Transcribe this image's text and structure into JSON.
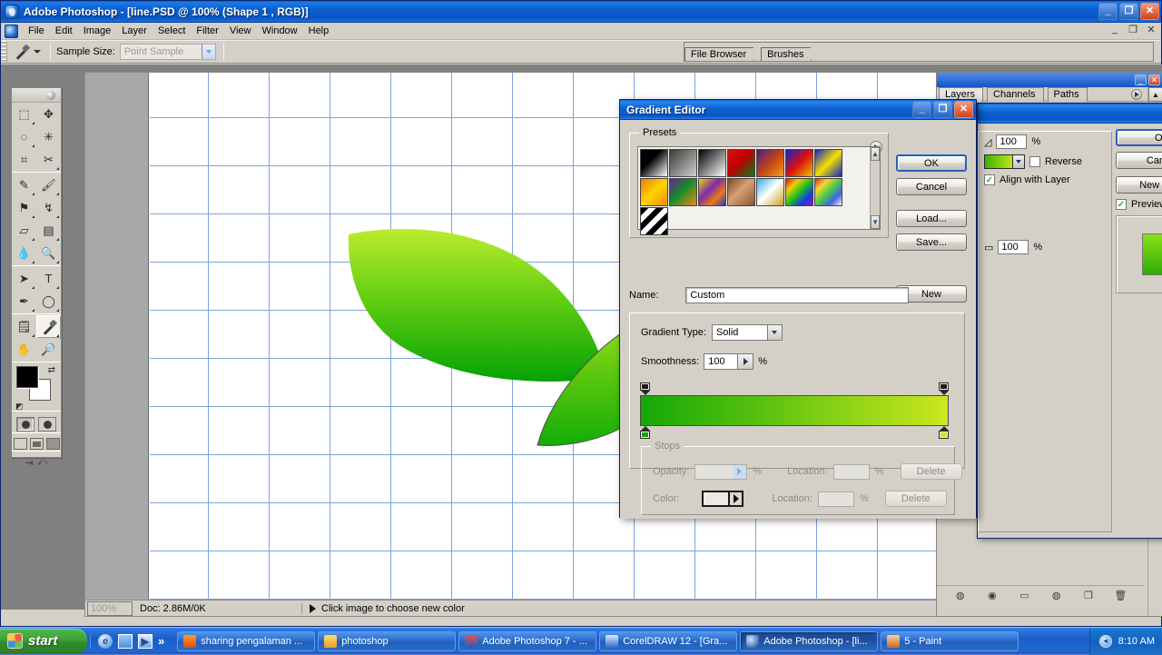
{
  "app": {
    "title": "Adobe Photoshop  - [line.PSD @ 100% (Shape 1 , RGB)]",
    "menus": [
      "File",
      "Edit",
      "Image",
      "Layer",
      "Select",
      "Filter",
      "View",
      "Window",
      "Help"
    ],
    "window_buttons": {
      "minimize": "_",
      "restore": "❐",
      "close": "✕"
    },
    "mdi_buttons": {
      "minimize": "_",
      "restore": "❐",
      "close": "✕"
    }
  },
  "options_bar": {
    "tool_icon": "eyedropper-icon",
    "sample_size_label": "Sample Size:",
    "sample_size_value": "Point Sample",
    "palette_well_tabs": [
      "File Browser",
      "Brushes"
    ]
  },
  "toolbox": {
    "tools": [
      "marquee-icon",
      "move-icon",
      "lasso-icon",
      "magic-wand-icon",
      "crop-icon",
      "slice-icon",
      "healing-brush-icon",
      "paintbrush-icon",
      "clone-stamp-icon",
      "history-brush-icon",
      "eraser-icon",
      "gradient-icon",
      "blur-icon",
      "dodge-icon",
      "path-selection-icon",
      "type-icon",
      "pen-icon",
      "ellipse-shape-icon",
      "notes-icon",
      "eyedropper-icon",
      "hand-icon",
      "zoom-icon"
    ],
    "selected_tool": "eyedropper-icon",
    "foreground_color": "#000000",
    "background_color": "#ffffff",
    "swap_icon": "swap-colors-icon",
    "default_icon": "default-colors-icon",
    "quickmask_modes": [
      "standard-mask-icon",
      "quick-mask-icon"
    ],
    "screen_modes": [
      "standard-screen-icon",
      "full-screen-menubar-icon",
      "full-screen-icon"
    ],
    "jump_to": [
      "jump-to-imageready-icon",
      "jump-to-second-icon"
    ]
  },
  "document": {
    "zoom": "100%",
    "doc_info": "Doc: 2.86M/0K",
    "status_hint": "Click image to choose new color",
    "canvas_background": "#ffffff",
    "grid_color": "#7ea3dd",
    "shapes": [
      {
        "name": "leaf-large",
        "gradient_from": "#b7e830",
        "gradient_to": "#0aa80a"
      },
      {
        "name": "leaf-small",
        "gradient_from": "#9be01a",
        "gradient_to": "#18b008"
      }
    ]
  },
  "layers_palette": {
    "tabs": [
      "Layers",
      "Channels",
      "Paths"
    ],
    "active_tab": "Layers",
    "bottom_icons": [
      "layer-style-icon",
      "layer-mask-icon",
      "new-group-icon",
      "adjustment-layer-icon",
      "new-layer-icon",
      "delete-layer-icon"
    ],
    "window_buttons": {
      "minimize": "_",
      "close": "✕"
    }
  },
  "gradient_editor": {
    "title": "Gradient Editor",
    "window_buttons": {
      "minimize": "_",
      "restore": "❐",
      "close": "✕"
    },
    "presets": {
      "legend": "Presets",
      "menu_icon": "preset-menu-icon",
      "scroll_up_icon": "scroll-up-icon",
      "scroll_down_icon": "scroll-down-icon",
      "items": [
        {
          "name": "foreground-to-background",
          "css": "linear-gradient(135deg,#000 0%,#000 38%,#ffffff 100%)"
        },
        {
          "name": "foreground-to-transparent",
          "css": "linear-gradient(135deg,#3a3a3a 0%,rgba(140,140,140,0.35) 100%)"
        },
        {
          "name": "black-white",
          "css": "linear-gradient(135deg,#000000 0%,#ffffff 100%)"
        },
        {
          "name": "red-green",
          "css": "linear-gradient(135deg,#e01010 0%,#c00000 45%,#0a7a18 100%)"
        },
        {
          "name": "violet-orange",
          "css": "linear-gradient(135deg,#4b1b8c 0%,#c84a10 55%,#f2a020 100%)"
        },
        {
          "name": "blue-red-yellow",
          "css": "linear-gradient(135deg,#1422c8 0%,#d81010 50%,#f5c000 100%)"
        },
        {
          "name": "blue-yellow-blue",
          "css": "linear-gradient(135deg,#1422c8 0%,#f5e000 50%,#1422c8 100%)"
        },
        {
          "name": "orange-yellow-orange",
          "css": "linear-gradient(135deg,#f07808 0%,#ffd400 50%,#f08c08 100%)"
        },
        {
          "name": "violet-green-orange",
          "css": "linear-gradient(135deg,#6a1e9c 0%,#148c2a 45%,#ef8a12 100%)"
        },
        {
          "name": "yellow-violet-orange-blue",
          "css": "linear-gradient(135deg,#f5d000 0%,#7a2ab0 40%,#ef7a12 70%,#1a3ad0 100%)"
        },
        {
          "name": "copper",
          "css": "linear-gradient(135deg,#7a4a28 0%,#d8a074 45%,#8a5632 100%)"
        },
        {
          "name": "chrome",
          "css": "linear-gradient(135deg,#3aa8e8 0%,#ffffff 48%,#c8a020 100%)"
        },
        {
          "name": "spectrum",
          "css": "linear-gradient(135deg,#e81010 0%,#f0d000 25%,#20c020 50%,#1040e0 75%,#9010c0 100%)"
        },
        {
          "name": "transparent-rainbow",
          "css": "linear-gradient(135deg,rgba(232,16,16,0.9) 0%,rgba(240,208,0,0.8) 25%,rgba(32,192,32,0.8) 50%,rgba(16,64,224,0.8) 75%,rgba(255,255,255,0.2) 100%)"
        },
        {
          "name": "transparent-stripes",
          "css": "repeating-linear-gradient(135deg,#000 0 6px,#ffffff 6px 12px)"
        }
      ]
    },
    "buttons": {
      "ok": "OK",
      "cancel": "Cancel",
      "load": "Load...",
      "save": "Save...",
      "new": "New"
    },
    "name_label": "Name:",
    "name_value": "Custom",
    "gradient_type_label": "Gradient Type:",
    "gradient_type_value": "Solid",
    "smoothness_label": "Smoothness:",
    "smoothness_value": "100",
    "percent_sign": "%",
    "gradient_bar": {
      "from_color": "#12a806",
      "to_color": "#cbe81e",
      "left_opacity_stop": "opacity-stop-left",
      "right_opacity_stop": "opacity-stop-right",
      "left_color_stop": "color-stop-left",
      "right_color_stop": "color-stop-right"
    },
    "stops": {
      "legend": "Stops",
      "opacity_label": "Opacity:",
      "opacity_value": "",
      "color_label": "Color:",
      "location_label_1": "Location:",
      "location_label_2": "Location:",
      "location_value_1": "",
      "location_value_2": "",
      "delete_label_1": "Delete",
      "delete_label_2": "Delete",
      "percent_1": "%",
      "percent_2": "%",
      "percent_3": "%"
    }
  },
  "layer_style": {
    "opacity_value": "100",
    "percent": "%",
    "gradient_swatch": "gradient-swatch",
    "reverse_label": "Reverse",
    "align_label": "Align with Layer",
    "scale_value": "100",
    "buttons": {
      "ok": "OK",
      "cancel": "Cancel",
      "new_style": "New Style"
    },
    "preview_label": "Preview",
    "preview_checked": "✓"
  },
  "taskbar": {
    "start_label": "start",
    "quick_launch": [
      "ie-icon",
      "show-desktop-icon",
      "media-player-icon"
    ],
    "chevron": "»",
    "tasks": [
      {
        "label": "sharing pengalaman ...",
        "icon": "firefox-icon",
        "active": false
      },
      {
        "label": "photoshop",
        "icon": "folder-icon",
        "active": false
      },
      {
        "label": "Adobe Photoshop 7 - ...",
        "icon": "book-icon",
        "active": false
      },
      {
        "label": "CorelDRAW 12 - [Gra...",
        "icon": "coreldraw-icon",
        "active": false
      },
      {
        "label": "Adobe Photoshop - [li...",
        "icon": "photoshop-icon",
        "active": true
      },
      {
        "label": "5 - Paint",
        "icon": "paint-icon",
        "active": false
      }
    ],
    "tray_icon": "volume-icon",
    "clock": "8:10 AM"
  }
}
